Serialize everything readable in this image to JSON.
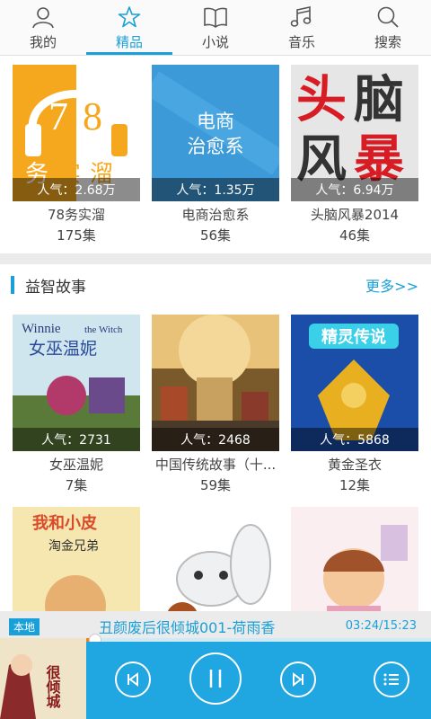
{
  "nav": {
    "tabs": [
      {
        "label": "我的",
        "icon": "person-icon"
      },
      {
        "label": "精品",
        "icon": "star-icon"
      },
      {
        "label": "小说",
        "icon": "book-icon"
      },
      {
        "label": "音乐",
        "icon": "music-note-icon"
      },
      {
        "label": "搜索",
        "icon": "search-icon"
      }
    ],
    "active": "精品",
    "accent_color": "#1aa0d8"
  },
  "row1": [
    {
      "cover_text": "78务实溜",
      "popularity": "人气：2.68万",
      "title": "78务实溜",
      "episodes": "175集"
    },
    {
      "cover_text": "电商 治愈系",
      "popularity": "人气：1.35万",
      "title": "电商治愈系",
      "episodes": "56集"
    },
    {
      "cover_text": "头脑风暴",
      "popularity": "人气：6.94万",
      "title": "头脑风暴2014",
      "episodes": "46集"
    }
  ],
  "section": {
    "title": "益智故事",
    "more": "更多>>"
  },
  "row2": [
    {
      "cover_text": "Winnie the Witch 女巫温妮",
      "popularity": "人气：2731",
      "title": "女巫温妮",
      "episodes": "7集"
    },
    {
      "popularity": "人气：2468",
      "title": "中国传统故事（十...",
      "episodes": "59集"
    },
    {
      "cover_text": "精灵传说",
      "popularity": "人气：5868",
      "title": "黄金圣衣",
      "episodes": "12集"
    }
  ],
  "row3": [
    {
      "cover_text": "我和小皮",
      "subtitle": "淘金兄弟"
    },
    {},
    {}
  ],
  "player": {
    "badge": "本地",
    "track": "丑颜废后很倾城001-荷雨香",
    "time": "03:24/15:23",
    "progress": 0.22,
    "color": "#20a6e0"
  }
}
